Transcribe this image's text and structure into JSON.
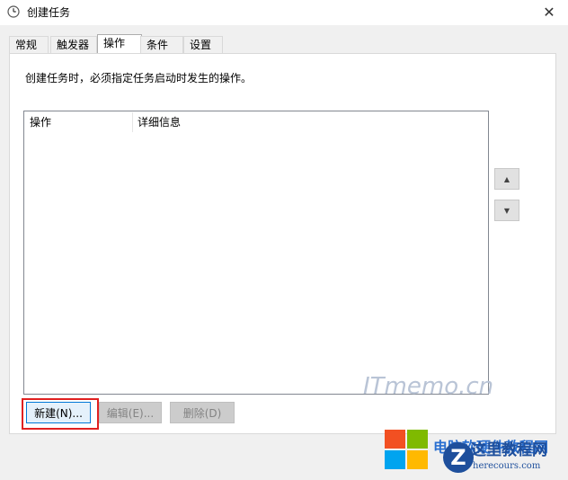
{
  "window": {
    "title": "创建任务"
  },
  "tabs": [
    {
      "label": "常规"
    },
    {
      "label": "触发器"
    },
    {
      "label": "操作",
      "active": true
    },
    {
      "label": "条件"
    },
    {
      "label": "设置"
    }
  ],
  "panel": {
    "description": "创建任务时，必须指定任务启动时发生的操作。",
    "columns": [
      "操作",
      "详细信息"
    ]
  },
  "buttons": {
    "new_label": "新建(N)...",
    "edit_label": "编辑(E)...",
    "delete_label": "删除(D)"
  },
  "watermark": {
    "itmemo": "ITmemo.cn",
    "overlay_blue": "电脑软硬件教程网",
    "site_cn": "这里教程网",
    "site_en": "herecours.com",
    "badge": "Z"
  },
  "colors": {
    "accent": "#0078d7",
    "highlight_box": "#e02020",
    "panel_bg": "#f0f0f0"
  }
}
